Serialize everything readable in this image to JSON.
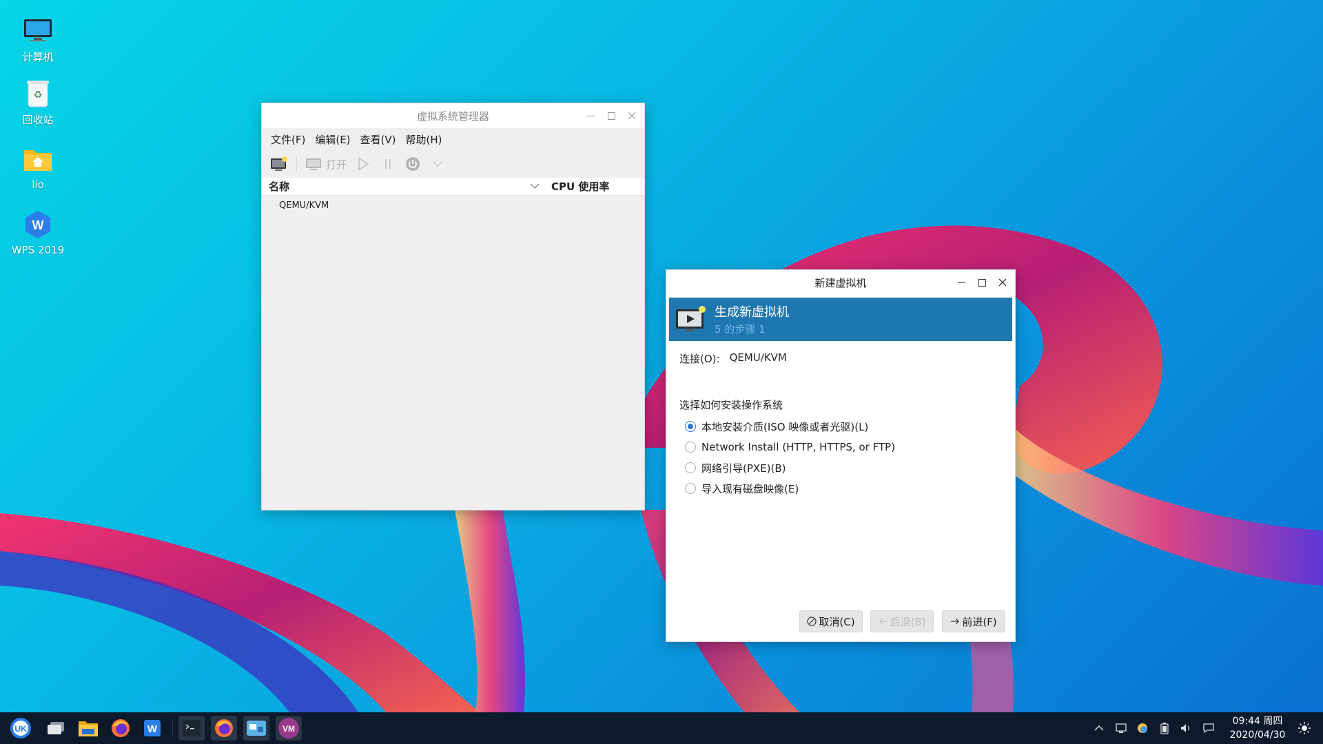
{
  "desktop": {
    "icons": [
      {
        "label": "计算机",
        "icon": "monitor-icon"
      },
      {
        "label": "回收站",
        "icon": "recycle-bin-icon"
      },
      {
        "label": "lio",
        "icon": "home-folder-icon"
      },
      {
        "label": "WPS 2019",
        "icon": "wps-icon"
      }
    ]
  },
  "manager": {
    "title": "虚拟系统管理器",
    "menus": [
      "文件(F)",
      "编辑(E)",
      "查看(V)",
      "帮助(H)"
    ],
    "toolbar": {
      "open_label": "打开"
    },
    "columns": {
      "name": "名称",
      "cpu": "CPU 使用率"
    },
    "rows": [
      "QEMU/KVM"
    ]
  },
  "wizard": {
    "title": "新建虚拟机",
    "header_title": "生成新虚拟机",
    "header_step": "5 的步骤 1",
    "connection_label": "连接(O):",
    "connection_value": "QEMU/KVM",
    "section_title": "选择如何安装操作系统",
    "options": [
      {
        "label": "本地安装介质(ISO 映像或者光驱)(L)",
        "selected": true
      },
      {
        "label": "Network Install (HTTP, HTTPS, or FTP)",
        "selected": false
      },
      {
        "label": "网络引导(PXE)(B)",
        "selected": false
      },
      {
        "label": "导入现有磁盘映像(E)",
        "selected": false
      }
    ],
    "buttons": {
      "cancel": "取消(C)",
      "back": "后退(B)",
      "forward": "前进(F)"
    }
  },
  "taskbar": {
    "apps": [
      "launcher-icon",
      "multitask-view-icon",
      "file-manager-icon",
      "firefox-icon",
      "wps-writer-icon",
      "terminal-icon",
      "firefox-icon",
      "remote-viewer-icon",
      "virt-manager-icon"
    ],
    "clock_time": "09:44 周四",
    "clock_date": "2020/04/30"
  },
  "colors": {
    "accent": "#1f77b0",
    "radio": "#2c7ad6",
    "taskbar": "#0d1a2c"
  }
}
